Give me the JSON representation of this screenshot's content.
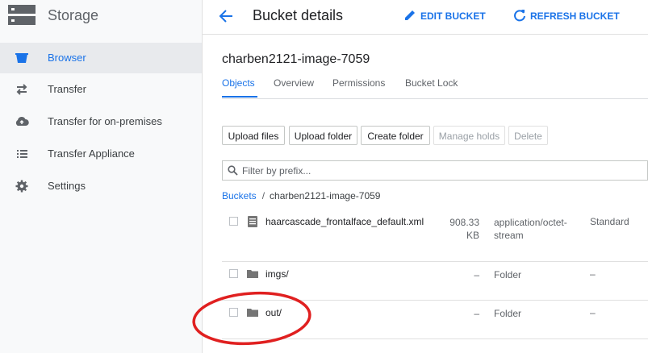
{
  "sidebar": {
    "title": "Storage",
    "items": [
      {
        "label": "Browser",
        "icon": "bucket-icon",
        "active": true
      },
      {
        "label": "Transfer",
        "icon": "transfer-arrows-icon"
      },
      {
        "label": "Transfer for on-premises",
        "icon": "cloud-upload-icon"
      },
      {
        "label": "Transfer Appliance",
        "icon": "list-icon"
      },
      {
        "label": "Settings",
        "icon": "gear-icon"
      }
    ]
  },
  "header": {
    "title": "Bucket details",
    "edit_label": "EDIT BUCKET",
    "refresh_label": "REFRESH BUCKET",
    "accent": "#1a73e8"
  },
  "bucket": {
    "name": "charben2121-image-7059"
  },
  "tabs": [
    {
      "label": "Objects",
      "active": true
    },
    {
      "label": "Overview"
    },
    {
      "label": "Permissions"
    },
    {
      "label": "Bucket Lock"
    }
  ],
  "toolbar": {
    "upload_files": "Upload files",
    "upload_folder": "Upload folder",
    "create_folder": "Create folder",
    "manage_holds": "Manage holds",
    "delete": "Delete"
  },
  "filter": {
    "placeholder": "Filter by prefix..."
  },
  "breadcrumb": {
    "root": "Buckets",
    "separator": "/",
    "current": "charben2121-image-7059"
  },
  "objects": [
    {
      "name": "haarcascade_frontalface_default.xml",
      "size_line1": "908.33",
      "size_line2": "KB",
      "type_line1": "application/octet-",
      "type_line2": "stream",
      "storage_class": "Standard",
      "icon": "file-icon"
    },
    {
      "name": "imgs/",
      "size": "–",
      "type": "Folder",
      "storage_class": "–",
      "icon": "folder-icon"
    },
    {
      "name": "out/",
      "size": "–",
      "type": "Folder",
      "storage_class": "–",
      "icon": "folder-icon"
    }
  ],
  "annotation_color": "#e02020"
}
